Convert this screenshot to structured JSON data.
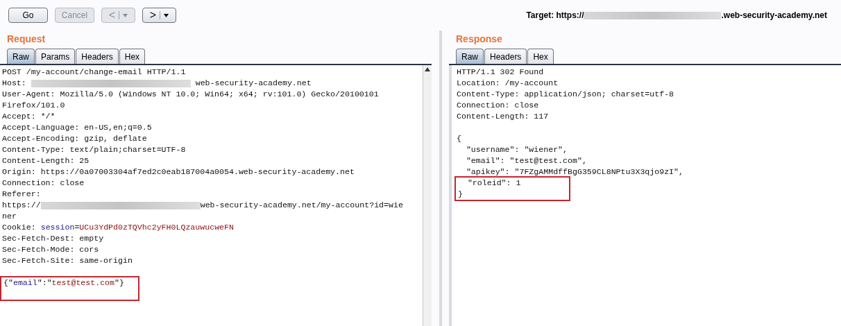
{
  "toolbar": {
    "buttons": [
      {
        "kind": "text",
        "label": "Go",
        "disabled": false
      },
      {
        "kind": "text",
        "label": "Cancel",
        "disabled": true
      },
      {
        "kind": "nav",
        "label": "<",
        "disabled": true
      },
      {
        "kind": "nav",
        "label": ">",
        "disabled": false
      }
    ],
    "target": [
      {
        "kind": "text",
        "text": "Target: https://"
      },
      {
        "kind": "redacted"
      },
      {
        "kind": "text",
        "text": ".web-security-academy.net"
      }
    ]
  },
  "panels": [
    {
      "title": "Request",
      "tabs": [
        {
          "label": "Raw",
          "selected": true
        },
        {
          "label": "Params",
          "selected": false
        },
        {
          "label": "Headers",
          "selected": false
        },
        {
          "label": "Hex",
          "selected": false
        }
      ],
      "lines": [
        {
          "highlighted": false,
          "segments": [
            {
              "kind": "text",
              "text": "POST /my-account/change-email HTTP/1.1"
            }
          ]
        },
        {
          "highlighted": false,
          "segments": [
            {
              "kind": "text",
              "text": "Host: "
            },
            {
              "kind": "redacted"
            },
            {
              "kind": "text",
              "text": " web-security-academy.net"
            }
          ]
        },
        {
          "highlighted": false,
          "segments": [
            {
              "kind": "text",
              "text": "User-Agent: Mozilla/5.0 (Windows NT 10.0; Win64; x64; rv:101.0) Gecko/20100101"
            }
          ]
        },
        {
          "highlighted": false,
          "segments": [
            {
              "kind": "text",
              "text": "Firefox/101.0"
            }
          ]
        },
        {
          "highlighted": false,
          "segments": [
            {
              "kind": "text",
              "text": "Accept: */*"
            }
          ]
        },
        {
          "highlighted": false,
          "segments": [
            {
              "kind": "text",
              "text": "Accept-Language: en-US,en;q=0.5"
            }
          ]
        },
        {
          "highlighted": false,
          "segments": [
            {
              "kind": "text",
              "text": "Accept-Encoding: gzip, deflate"
            }
          ]
        },
        {
          "highlighted": false,
          "segments": [
            {
              "kind": "text",
              "text": "Content-Type: text/plain;charset=UTF-8"
            }
          ]
        },
        {
          "highlighted": false,
          "segments": [
            {
              "kind": "text",
              "text": "Content-Length: 25"
            }
          ]
        },
        {
          "highlighted": false,
          "segments": [
            {
              "kind": "text",
              "text": "Origin: https://0a07003304af7ed2c0eab187004a0054.web-security-academy.net"
            }
          ]
        },
        {
          "highlighted": false,
          "segments": [
            {
              "kind": "text",
              "text": "Connection: close"
            }
          ]
        },
        {
          "highlighted": false,
          "segments": [
            {
              "kind": "text",
              "text": "Referer:"
            }
          ]
        },
        {
          "highlighted": false,
          "segments": [
            {
              "kind": "text",
              "text": "https://"
            },
            {
              "kind": "redacted"
            },
            {
              "kind": "text",
              "text": "web-security-academy.net/my-account?id=wie"
            }
          ]
        },
        {
          "highlighted": false,
          "segments": [
            {
              "kind": "text",
              "text": "ner"
            }
          ]
        },
        {
          "highlighted": false,
          "segments": [
            {
              "kind": "text",
              "text": "Cookie: "
            },
            {
              "kind": "key",
              "text": "session"
            },
            {
              "kind": "text",
              "text": "="
            },
            {
              "kind": "value",
              "text": "UCu3YdPd0zTQVhc2yFH0LQzauwucweFN"
            }
          ]
        },
        {
          "highlighted": false,
          "segments": [
            {
              "kind": "text",
              "text": "Sec-Fetch-Dest: empty"
            }
          ]
        },
        {
          "highlighted": false,
          "segments": [
            {
              "kind": "text",
              "text": "Sec-Fetch-Mode: cors"
            }
          ]
        },
        {
          "highlighted": false,
          "segments": [
            {
              "kind": "text",
              "text": "Sec-Fetch-Site: same-origin"
            }
          ]
        },
        {
          "kind": "blank"
        },
        {
          "highlighted": true,
          "segments": [
            {
              "kind": "text",
              "text": "{\""
            },
            {
              "kind": "key",
              "text": "email"
            },
            {
              "kind": "text",
              "text": "\":\""
            },
            {
              "kind": "value",
              "text": "test@test.com"
            },
            {
              "kind": "text",
              "text": "\"}"
            }
          ]
        }
      ]
    },
    {
      "title": "Response",
      "tabs": [
        {
          "label": "Raw",
          "selected": true
        },
        {
          "label": "Headers",
          "selected": false
        },
        {
          "label": "Hex",
          "selected": false
        }
      ],
      "lines": [
        {
          "highlighted": false,
          "segments": [
            {
              "kind": "text",
              "text": "HTTP/1.1 302 Found"
            }
          ]
        },
        {
          "highlighted": false,
          "segments": [
            {
              "kind": "text",
              "text": "Location: /my-account"
            }
          ]
        },
        {
          "highlighted": false,
          "segments": [
            {
              "kind": "text",
              "text": "Content-Type: application/json; charset=utf-8"
            }
          ]
        },
        {
          "highlighted": false,
          "segments": [
            {
              "kind": "text",
              "text": "Connection: close"
            }
          ]
        },
        {
          "highlighted": false,
          "segments": [
            {
              "kind": "text",
              "text": "Content-Length: 117"
            }
          ]
        },
        {
          "kind": "blank"
        },
        {
          "highlighted": false,
          "segments": [
            {
              "kind": "text",
              "text": "{"
            }
          ]
        },
        {
          "highlighted": false,
          "segments": [
            {
              "kind": "text",
              "text": "  \"username\": \"wiener\","
            }
          ]
        },
        {
          "highlighted": false,
          "segments": [
            {
              "kind": "text",
              "text": "  \"email\": \"test@test.com\","
            }
          ]
        },
        {
          "highlighted": false,
          "segments": [
            {
              "kind": "text",
              "text": "  \"apikey\": \"7FZgAMMdffBgG359CL8NPtu3X3qjo9zI\","
            }
          ]
        },
        {
          "highlighted": true,
          "segments": [
            {
              "kind": "text",
              "text": "  \"roleid\": 1"
            }
          ]
        },
        {
          "highlighted": true,
          "segments": [
            {
              "kind": "text",
              "text": "}"
            }
          ]
        }
      ]
    }
  ]
}
